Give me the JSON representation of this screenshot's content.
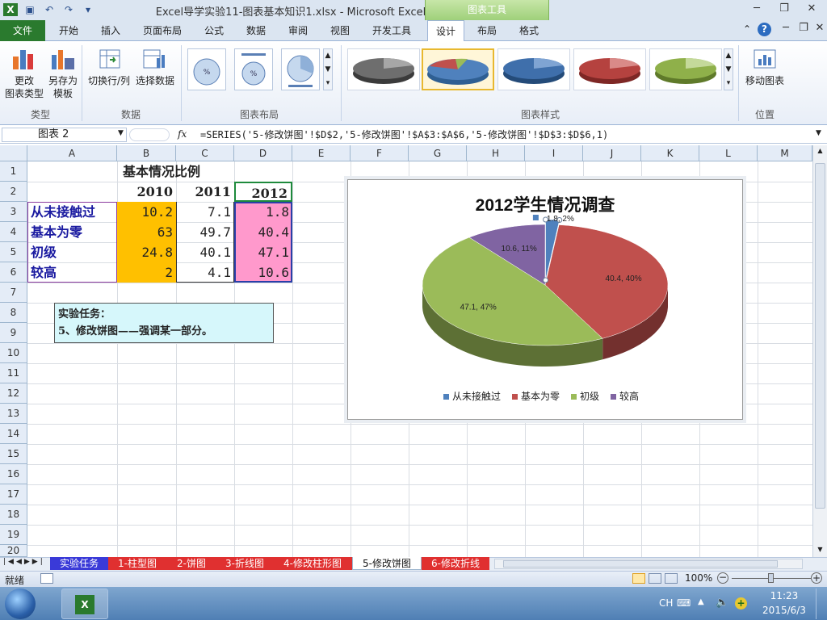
{
  "window": {
    "title": "Excel导学实验11-图表基本知识1.xlsx  -  Microsoft Excel",
    "context_tab_group": "图表工具"
  },
  "ribbon_tabs": [
    "文件",
    "开始",
    "插入",
    "页面布局",
    "公式",
    "数据",
    "审阅",
    "视图",
    "开发工具",
    "设计",
    "布局",
    "格式"
  ],
  "ribbon": {
    "type_group": {
      "label": "类型",
      "change_type": "更改\n图表类型",
      "save_template": "另存为\n模板"
    },
    "data_group": {
      "label": "数据",
      "switch": "切换行/列",
      "select": "选择数据"
    },
    "layout_group": {
      "label": "图表布局"
    },
    "style_group": {
      "label": "图表样式"
    },
    "location_group": {
      "label": "位置",
      "move": "移动图表"
    }
  },
  "formula_bar": {
    "name_box": "图表 2",
    "fx": "fx",
    "formula": "=SERIES('5-修改饼图'!$D$2,'5-修改饼图'!$A$3:$A$6,'5-修改饼图'!$D$3:$D$6,1)"
  },
  "columns": [
    "A",
    "B",
    "C",
    "D",
    "E",
    "F",
    "G",
    "H",
    "I",
    "J",
    "K",
    "L",
    "M"
  ],
  "rows": [
    "1",
    "2",
    "3",
    "4",
    "5",
    "6",
    "7",
    "8",
    "9",
    "10",
    "11",
    "12",
    "13",
    "14",
    "15",
    "16",
    "17",
    "18",
    "19",
    "20"
  ],
  "table": {
    "title": "基本情况比例",
    "headers": [
      "2010",
      "2011",
      "2012"
    ],
    "rows": [
      {
        "label": "从未接触过",
        "v2010": "10.2",
        "v2011": "7.1",
        "v2012": "1.8"
      },
      {
        "label": "基本为零",
        "v2010": "63",
        "v2011": "49.7",
        "v2012": "40.4"
      },
      {
        "label": "初级",
        "v2010": "24.8",
        "v2011": "40.1",
        "v2012": "47.1"
      },
      {
        "label": "较高",
        "v2010": "2",
        "v2011": "4.1",
        "v2012": "10.6"
      }
    ]
  },
  "note": {
    "line1": "实验任务：",
    "line2": "5、修改饼图——强调某一部分。"
  },
  "chart_data": {
    "type": "pie",
    "title": "2012学生情况调查",
    "categories": [
      "从未接触过",
      "基本为零",
      "初级",
      "较高"
    ],
    "values": [
      1.8,
      40.4,
      47.1,
      10.6
    ],
    "data_labels": [
      "1.8, 2%",
      "40.4, 40%",
      "47.1, 47%",
      "10.6, 11%"
    ],
    "colors": [
      "#4f81bd",
      "#c0504d",
      "#9bbb59",
      "#8064a2"
    ],
    "legend_position": "bottom",
    "exploded": "从未接触过"
  },
  "sheet_tabs": [
    "实验任务",
    "1-柱型图",
    "2-饼图",
    "3-折线图",
    "4-修改柱形图",
    "5-修改饼图",
    "6-修改折线"
  ],
  "active_sheet": "5-修改饼图",
  "status": {
    "ready": "就绪",
    "zoom": "100%"
  },
  "taskbar": {
    "lang": "CH",
    "time": "11:23",
    "date": "2015/6/3"
  }
}
